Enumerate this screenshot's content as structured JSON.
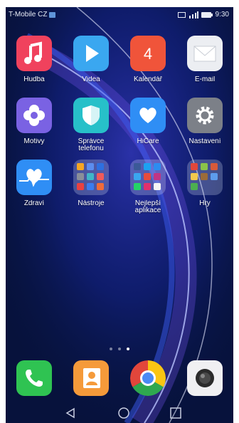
{
  "status_bar": {
    "carrier": "T-Mobile CZ",
    "time": "9:30"
  },
  "apps": [
    {
      "label": "Hudba",
      "icon": "music-note-icon",
      "color": "#f0425d"
    },
    {
      "label": "Videa",
      "icon": "play-icon",
      "color": "#3aa7f0"
    },
    {
      "label": "Kalendář",
      "icon": "calendar-icon",
      "color": "#f0543a",
      "badge": "4"
    },
    {
      "label": "E-mail",
      "icon": "envelope-icon",
      "color": "#eceef2"
    },
    {
      "label": "Motivy",
      "icon": "themes-flower-icon",
      "color": "#7a62e3"
    },
    {
      "label": "Správce\ntelefonu",
      "icon": "shield-icon",
      "color": "#27c0c9"
    },
    {
      "label": "HiCare",
      "icon": "heart-icon",
      "color": "#2f8ef5"
    },
    {
      "label": "Nastavení",
      "icon": "gear-icon",
      "color": "#7c8088"
    },
    {
      "label": "Zdraví",
      "icon": "health-heartbeat-icon",
      "color": "#2f8ef5"
    },
    {
      "label": "Nástroje",
      "icon": "folder-icon"
    },
    {
      "label": "Nejlepší\naplikace",
      "icon": "folder-icon"
    },
    {
      "label": "Hry",
      "icon": "folder-icon"
    }
  ],
  "page_indicator": {
    "pages": 3,
    "active": 3
  },
  "dock": [
    {
      "name": "phone",
      "icon": "phone-icon",
      "color": "#2fc352"
    },
    {
      "name": "contacts",
      "icon": "contacts-icon",
      "color": "#f59a3a"
    },
    {
      "name": "chrome",
      "icon": "chrome-icon"
    },
    {
      "name": "camera",
      "icon": "camera-icon",
      "color": "#f0f0f2"
    }
  ],
  "nav_buttons": [
    "back-icon",
    "home-icon",
    "recents-icon"
  ]
}
